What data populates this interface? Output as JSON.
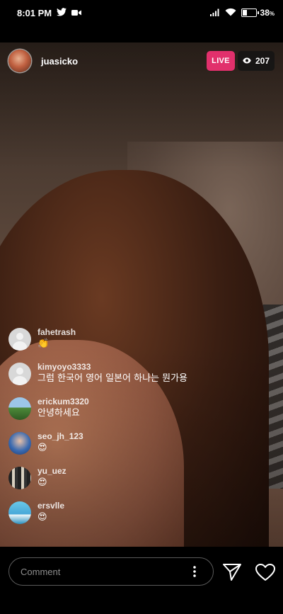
{
  "status_bar": {
    "time": "8:01 PM",
    "battery": "38",
    "battery_unit": "%",
    "battery_level": 0.38
  },
  "live": {
    "host_username": "juasicko",
    "live_label": "LIVE",
    "viewer_count": "207"
  },
  "comments": [
    {
      "username": "fahetrash",
      "message": "👏",
      "avatar": "default-avatar"
    },
    {
      "username": "kimyoyo3333",
      "message": "그럼 한국어 영어 일본어 하나는 뭔가용",
      "avatar": "default-avatar"
    },
    {
      "username": "erickum3320",
      "message": "안녕하세요",
      "avatar": "landscape-avatar"
    },
    {
      "username": "seo_jh_123",
      "message": "😍",
      "avatar": "person-avatar"
    },
    {
      "username": "yu_uez",
      "message": "😍",
      "avatar": "group-avatar"
    },
    {
      "username": "ersvlle",
      "message": "😍",
      "avatar": "sky-avatar"
    }
  ],
  "composer": {
    "placeholder": "Comment"
  },
  "colors": {
    "live_badge": "#e1306c",
    "background": "#000000"
  }
}
